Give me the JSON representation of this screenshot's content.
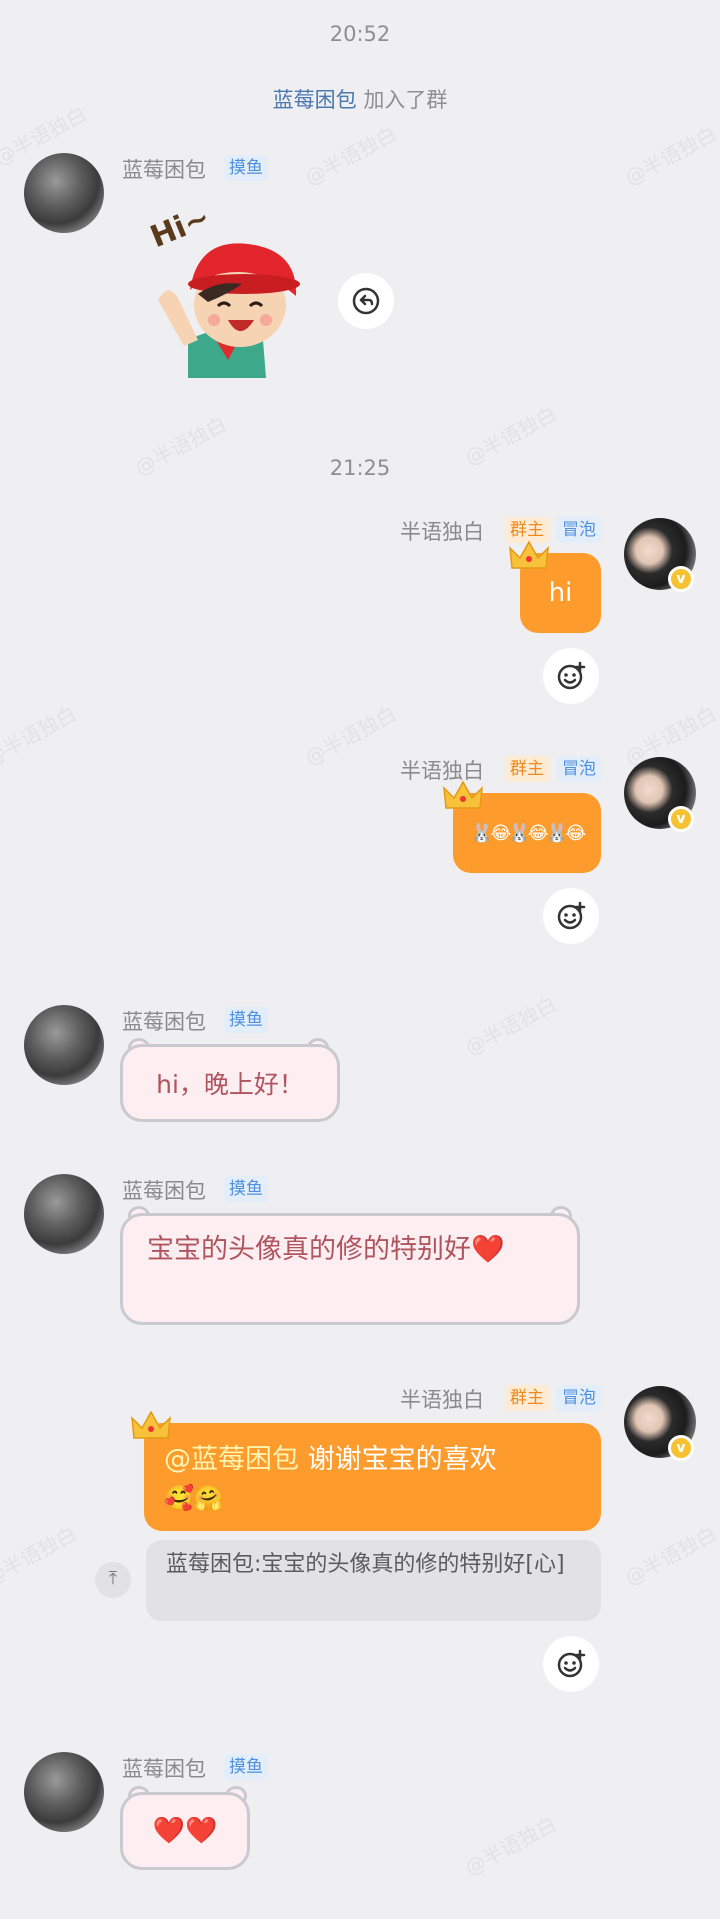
{
  "timestamps": [
    "20:52",
    "21:25"
  ],
  "system_message": {
    "name": "蓝莓困包",
    "action": "加入了群"
  },
  "users": {
    "left": {
      "nickname": "蓝莓困包",
      "tag": "摸鱼"
    },
    "right": {
      "nickname": "半语独白",
      "tag_owner": "群主",
      "tag_level": "冒泡",
      "badge": "v"
    }
  },
  "sticker": {
    "text": "Hi~"
  },
  "messages": {
    "m2": "hi",
    "m3": "🐰😂🐰😂🐰😂",
    "m4": "hi，晚上好！",
    "m5": "宝宝的头像真的修的特别好❤️",
    "m6_mention": "@蓝莓困包",
    "m6_text": " 谢谢宝宝的喜欢",
    "m6_emoji": "🥰🤗",
    "m6_quote": "蓝莓困包:宝宝的头像真的修的特别好[心]",
    "m7": "❤️❤️"
  },
  "watermark": "@半语独白",
  "icons": {
    "reply": "reply-arrow-icon",
    "reaction": "add-reaction-icon",
    "quote": "quote-up-arrow-icon",
    "crown": "crown-icon"
  },
  "colors": {
    "background": "#efeff1",
    "orange_bubble": "#fd9c2c",
    "pink_bubble": "#fdeef2",
    "tag_blue": "#4d8fe0",
    "tag_orange": "#f08a1c"
  }
}
